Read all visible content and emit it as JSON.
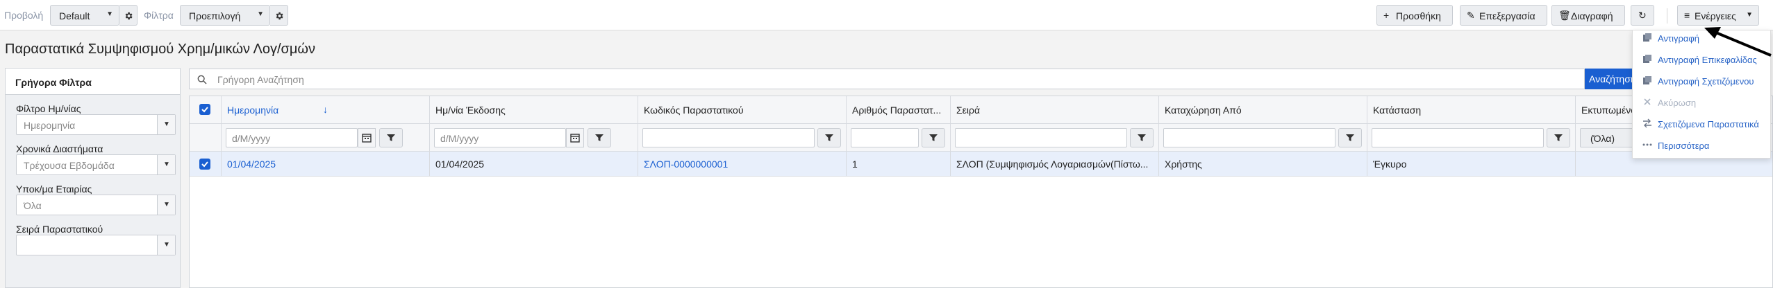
{
  "toolbar": {
    "view_label": "Προβολή",
    "view_value": "Default",
    "filters_label": "Φίλτρα",
    "filters_value": "Προεπιλογή",
    "add": "Προσθήκη",
    "edit": "Επεξεργασία",
    "delete": "Διαγραφή",
    "actions": "Ενέργειες"
  },
  "page_title": "Παραστατικά Συμψηφισμού Χρημ/μικών Λογ/σμών",
  "quick_filters": {
    "title": "Γρήγορα Φίλτρα",
    "fields": [
      {
        "label": "Φίλτρο Ημ/νίας",
        "value": "Ημερομηνία"
      },
      {
        "label": "Χρονικά Διαστήματα",
        "value": "Τρέχουσα Εβδομάδα"
      },
      {
        "label": "Υποκ/μα Εταιρίας",
        "value": "Όλα"
      },
      {
        "label": "Σειρά Παραστατικού",
        "value": ""
      }
    ]
  },
  "search": {
    "placeholder": "Γρήγορη Αναζήτηση",
    "button": "Αναζήτηση"
  },
  "grid": {
    "columns": [
      "Ημερομηνία",
      "Ημ/νία Έκδοσης",
      "Κωδικός Παραστατικού",
      "Αριθμός Παραστατ...",
      "Σειρά",
      "Καταχώρηση Από",
      "Κατάσταση",
      "Εκτυπωμένο"
    ],
    "filters": {
      "date_placeholder": "d/M/yyyy",
      "issue_placeholder": "d/M/yyyy",
      "printed_value": "(Όλα)"
    },
    "rows": [
      {
        "date": "01/04/2025",
        "issue_date": "01/04/2025",
        "code": "ΣΛΟΠ-0000000001",
        "number": "1",
        "series": "ΣΛΟΠ (Συμψηφισμός Λογαριασμών(Πίστω...",
        "entered_by": "Χρήστης",
        "status": "Έγκυρο",
        "printed": ""
      }
    ]
  },
  "actions_menu": {
    "items": [
      {
        "label": "Αντιγραφή",
        "icon": "copy-icon",
        "disabled": false
      },
      {
        "label": "Αντιγραφή Επικεφαλίδας",
        "icon": "copy-header-icon",
        "disabled": false
      },
      {
        "label": "Αντιγραφή Σχετιζόμενου",
        "icon": "copy-related-icon",
        "disabled": false
      },
      {
        "label": "Ακύρωση",
        "icon": "cancel-icon",
        "disabled": true
      },
      {
        "label": "Σχετιζόμενα Παραστατικά",
        "icon": "related-documents-icon",
        "disabled": false
      },
      {
        "label": "Περισσότερα",
        "icon": "more-icon",
        "disabled": false
      }
    ]
  },
  "colors": {
    "accent": "#1a5fd1",
    "selected_row": "#e8effb",
    "menu_link": "#2a65c7",
    "disabled": "#aab3c2"
  }
}
